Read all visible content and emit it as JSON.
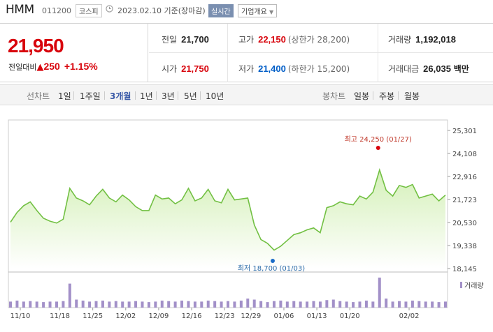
{
  "header": {
    "name": "HMM",
    "code": "011200",
    "market": "코스피",
    "clock_icon": "clock-icon",
    "date": "2023.02.10 기준(장마감)",
    "live": "실시간",
    "company_info": "기업개요"
  },
  "quote": {
    "price": "21,950",
    "change_label": "전일대비",
    "change_value": "250",
    "change_pct": "+1.15%",
    "prev_close_label": "전일",
    "prev_close": "21,700",
    "high_label": "고가",
    "high": "22,150",
    "upper_limit": "(상한가 28,200)",
    "volume_label": "거래량",
    "volume": "1,192,018",
    "open_label": "시가",
    "open": "21,750",
    "low_label": "저가",
    "low": "21,400",
    "lower_limit": "(하한가 15,200)",
    "amount_label": "거래대금",
    "amount": "26,035",
    "amount_unit": "백만",
    "colors": {
      "up": "#d8040c",
      "down": "#005dc7"
    }
  },
  "tabs": {
    "line_label": "선차트",
    "line": [
      "1일",
      "1주일",
      "3개월",
      "1년",
      "3년",
      "5년",
      "10년"
    ],
    "active": "3개월",
    "candle_label": "봉차트",
    "candle": [
      "일봉",
      "주봉",
      "월봉"
    ]
  },
  "chart_data": {
    "type": "area",
    "y_ticks": [
      "25,301",
      "24,108",
      "22,916",
      "21,723",
      "20,530",
      "19,338",
      "18,145"
    ],
    "ylim": [
      18145,
      25301
    ],
    "x_ticks": [
      "11/10",
      "11/18",
      "11/25",
      "12/02",
      "12/09",
      "12/16",
      "12/23",
      "12/29",
      "01/06",
      "01/13",
      "01/20",
      "02/02"
    ],
    "values": [
      20550,
      21050,
      21400,
      21600,
      21150,
      20750,
      20600,
      20500,
      20700,
      22300,
      21800,
      21650,
      21450,
      21900,
      22250,
      21800,
      21600,
      21950,
      21700,
      21350,
      21150,
      21150,
      21950,
      21750,
      21800,
      21500,
      21700,
      22300,
      21650,
      21800,
      22250,
      21650,
      21550,
      22250,
      21700,
      21750,
      21800,
      20400,
      19650,
      19450,
      19100,
      19300,
      19600,
      19900,
      20000,
      20150,
      20250,
      20000,
      21300,
      21400,
      21600,
      21500,
      21450,
      21900,
      21750,
      22100,
      23250,
      22200,
      21900,
      22450,
      22350,
      22500,
      21800,
      21900,
      22000,
      21650,
      21950
    ],
    "volume_values": [
      12,
      14,
      12,
      13,
      12,
      11,
      12,
      12,
      13,
      48,
      16,
      14,
      12,
      13,
      14,
      12,
      13,
      12,
      12,
      13,
      12,
      11,
      12,
      14,
      13,
      12,
      14,
      13,
      12,
      12,
      14,
      13,
      12,
      13,
      12,
      14,
      18,
      16,
      13,
      11,
      13,
      14,
      12,
      13,
      12,
      12,
      13,
      12,
      15,
      16,
      13,
      12,
      11,
      12,
      14,
      12,
      60,
      18,
      12,
      13,
      12,
      14,
      13,
      12,
      12,
      11,
      12
    ],
    "volume_label": "거래량",
    "max_annotation": "최고 24,250 (01/27)",
    "min_annotation": "최저 18,700 (01/03)",
    "max_index": 56,
    "min_index": 40,
    "colors": {
      "line": "#72c043",
      "fill_top": "#d4f0b8",
      "volume": "#a290c8",
      "max_dot": "#d8040c",
      "min_dot": "#1a6cc8"
    }
  }
}
